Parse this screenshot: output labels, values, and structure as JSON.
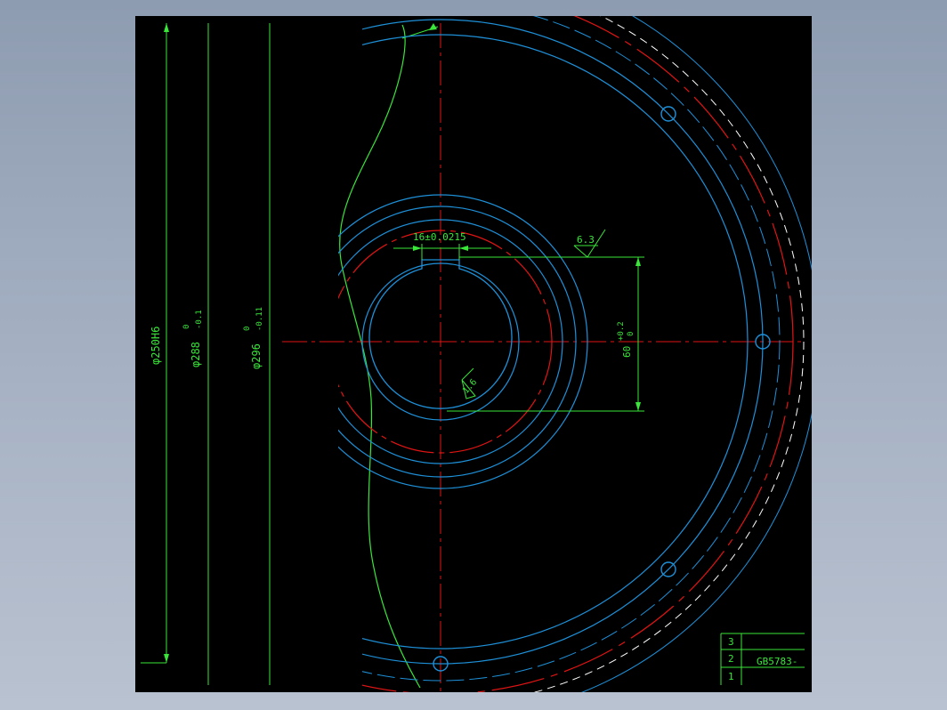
{
  "drawing": {
    "dims": {
      "d250": "φ250H6",
      "d288": "φ288",
      "d288_tol": "0",
      "d288_tol_low": "-0.1",
      "d296": "φ296",
      "d296_tol": "0",
      "d296_tol_low": "-0.11",
      "keyway_width": "16±0.0215",
      "hub_height": "60",
      "hub_tol_up": "+0.2",
      "hub_tol_low": "0",
      "roughness_a": "6.3",
      "roughness_b": "1.6"
    },
    "title_block": {
      "row1_num": "3",
      "row2_num": "2",
      "row2_text": "GB5783-",
      "row3_num": "1"
    }
  },
  "colors": {
    "viewport_bg": "#000000",
    "outline_blue": "#1e90d8",
    "center_red": "#e01414",
    "dim_green": "#39e639",
    "hidden_white": "#ffffff",
    "frame_bg": "#8e9cb1"
  }
}
